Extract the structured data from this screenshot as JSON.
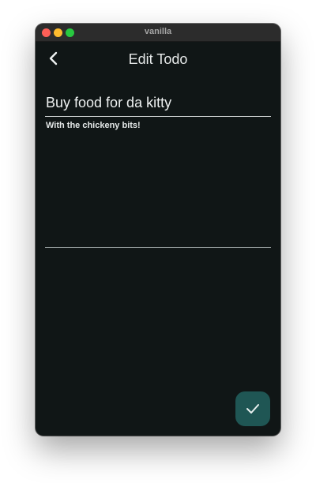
{
  "window": {
    "title": "vanilla"
  },
  "appbar": {
    "title": "Edit Todo",
    "back_icon": "chevron-left-icon"
  },
  "form": {
    "title_value": "Buy food for da kitty",
    "description_value": "With the chickeny bits!"
  },
  "fab": {
    "icon": "check-icon"
  },
  "colors": {
    "background": "#101616",
    "fab": "#1f5654",
    "text": "#eef1f1"
  }
}
